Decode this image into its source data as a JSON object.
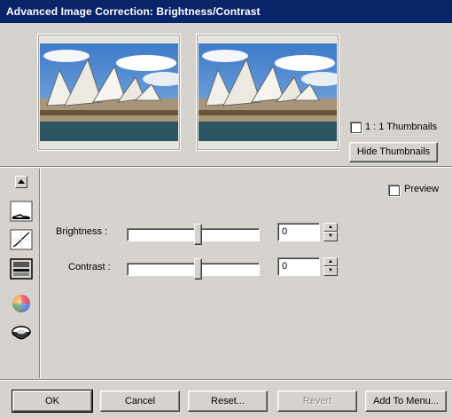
{
  "window": {
    "title": "Advanced Image Correction: Brightness/Contrast"
  },
  "thumbnails": {
    "one_to_one_label": "1 : 1 Thumbnails",
    "one_to_one_checked": false,
    "hide_label": "Hide Thumbnails"
  },
  "preview": {
    "label": "Preview",
    "checked": false
  },
  "controls": {
    "brightness": {
      "label": "Brightness :",
      "value": "0",
      "slider_fraction": 0.5
    },
    "contrast": {
      "label": "Contrast :",
      "value": "0",
      "slider_fraction": 0.5
    }
  },
  "tools": [
    {
      "icon": "collapse-up-icon"
    },
    {
      "icon": "histogram-icon"
    },
    {
      "icon": "tone-curve-icon"
    },
    {
      "icon": "brightness-contrast-icon"
    },
    {
      "icon": "color-wheel-icon"
    },
    {
      "icon": "lens-icon"
    }
  ],
  "buttons": {
    "ok": "OK",
    "cancel": "Cancel",
    "reset": "Reset...",
    "revert": "Revert",
    "add_to_menu": "Add To Menu..."
  },
  "colors": {
    "titlebar": "#0a246a",
    "face": "#d6d3ce",
    "sky": "#5a8fd0"
  }
}
